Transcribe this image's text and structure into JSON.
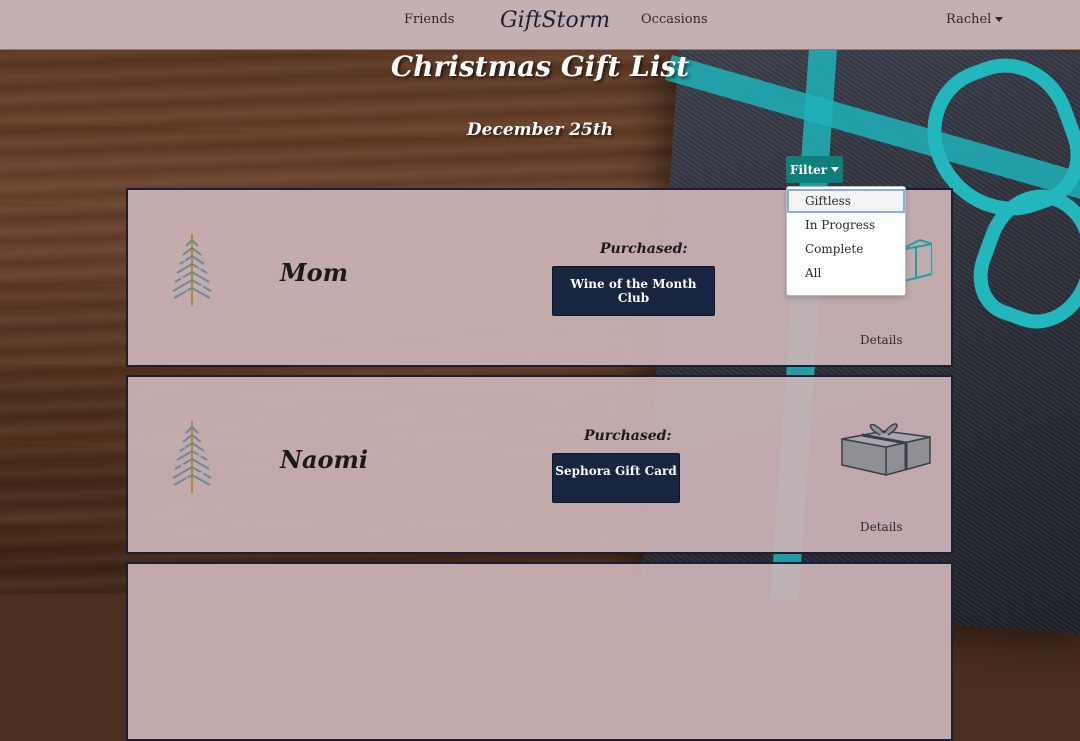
{
  "navbar": {
    "friends": "Friends",
    "brand": "GiftStorm",
    "occasions": "Occasions",
    "user": "Rachel"
  },
  "page": {
    "title": "Christmas Gift List",
    "date": "December 25th"
  },
  "filter": {
    "label": "Filter",
    "options": [
      "Giftless",
      "In Progress",
      "Complete",
      "All"
    ],
    "highlighted": "Giftless"
  },
  "people": [
    {
      "name": "Mom",
      "status_label": "Purchased:",
      "gift": "Wine of the Month Club",
      "details": "Details"
    },
    {
      "name": "Naomi",
      "status_label": "Purchased:",
      "gift": "Sephora Gift Card",
      "details": "Details"
    }
  ],
  "icons": {
    "tree": "christmas-tree-icon",
    "gift": "gift-box-icon"
  },
  "colors": {
    "navbar": "#c5b0b1",
    "filter_button": "#0f7f7c",
    "gift_button": "#172540",
    "card": "#cbb4b6"
  }
}
